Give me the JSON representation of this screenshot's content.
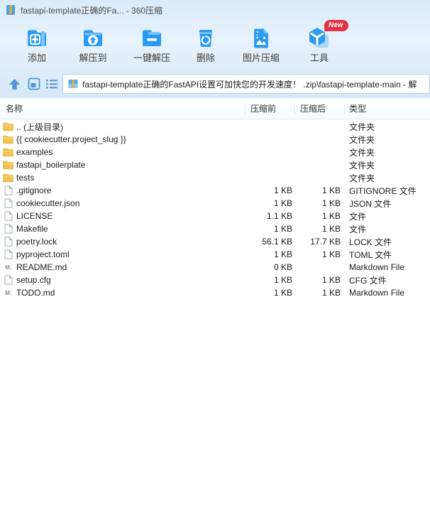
{
  "window": {
    "title": "fastapi-template正确的Fa... - 360压缩"
  },
  "toolbar": {
    "items": [
      {
        "id": "add",
        "label": "添加"
      },
      {
        "id": "extract-to",
        "label": "解压到"
      },
      {
        "id": "one-click-extract",
        "label": "一键解压"
      },
      {
        "id": "delete",
        "label": "删除"
      },
      {
        "id": "image-compress",
        "label": "图片压缩"
      },
      {
        "id": "tools",
        "label": "工具",
        "badge": "New"
      }
    ]
  },
  "navbar": {
    "path": "fastapi-template正确的FastAPI设置可加快您的开发速度！ .zip\\fastapi-template-main - 解"
  },
  "filelist": {
    "columns": [
      {
        "key": "name",
        "label": "名称"
      },
      {
        "key": "size_before",
        "label": "压缩前"
      },
      {
        "key": "size_after",
        "label": "压缩后"
      },
      {
        "key": "type",
        "label": "类型"
      }
    ],
    "rows": [
      {
        "name": ".. (上级目录)",
        "icon": "folder",
        "size_before": "",
        "size_after": "",
        "type": "文件夹"
      },
      {
        "name": "{{ cookiecutter.project_slug }}",
        "icon": "folder",
        "size_before": "",
        "size_after": "",
        "type": "文件夹"
      },
      {
        "name": "examples",
        "icon": "folder",
        "size_before": "",
        "size_after": "",
        "type": "文件夹"
      },
      {
        "name": "fastapi_boilerplate",
        "icon": "folder",
        "size_before": "",
        "size_after": "",
        "type": "文件夹"
      },
      {
        "name": "tests",
        "icon": "folder",
        "size_before": "",
        "size_after": "",
        "type": "文件夹"
      },
      {
        "name": ".gitignore",
        "icon": "file",
        "size_before": "1 KB",
        "size_after": "1 KB",
        "type": "GITIGNORE 文件"
      },
      {
        "name": "cookiecutter.json",
        "icon": "file",
        "size_before": "1 KB",
        "size_after": "1 KB",
        "type": "JSON 文件"
      },
      {
        "name": "LICENSE",
        "icon": "file",
        "size_before": "1.1 KB",
        "size_after": "1 KB",
        "type": "文件"
      },
      {
        "name": "Makefile",
        "icon": "file",
        "size_before": "1 KB",
        "size_after": "1 KB",
        "type": "文件"
      },
      {
        "name": "poetry.lock",
        "icon": "file",
        "size_before": "56.1 KB",
        "size_after": "17.7 KB",
        "type": "LOCK 文件"
      },
      {
        "name": "pyproject.toml",
        "icon": "file",
        "size_before": "1 KB",
        "size_after": "1 KB",
        "type": "TOML 文件"
      },
      {
        "name": "README.md",
        "icon": "markdown",
        "size_before": "0 KB",
        "size_after": "",
        "type": "Markdown File"
      },
      {
        "name": "setup.cfg",
        "icon": "file",
        "size_before": "1 KB",
        "size_after": "1 KB",
        "type": "CFG 文件"
      },
      {
        "name": "TODO.md",
        "icon": "markdown",
        "size_before": "1 KB",
        "size_after": "1 KB",
        "type": "Markdown File"
      }
    ]
  },
  "icons": {
    "markdown_glyph": "M↓"
  },
  "colors": {
    "accent_blue": "#2b9bf4",
    "folder_yellow": "#f2c14e",
    "badge_red": "#e53346",
    "chrome_blue": "#d9ebfb"
  }
}
